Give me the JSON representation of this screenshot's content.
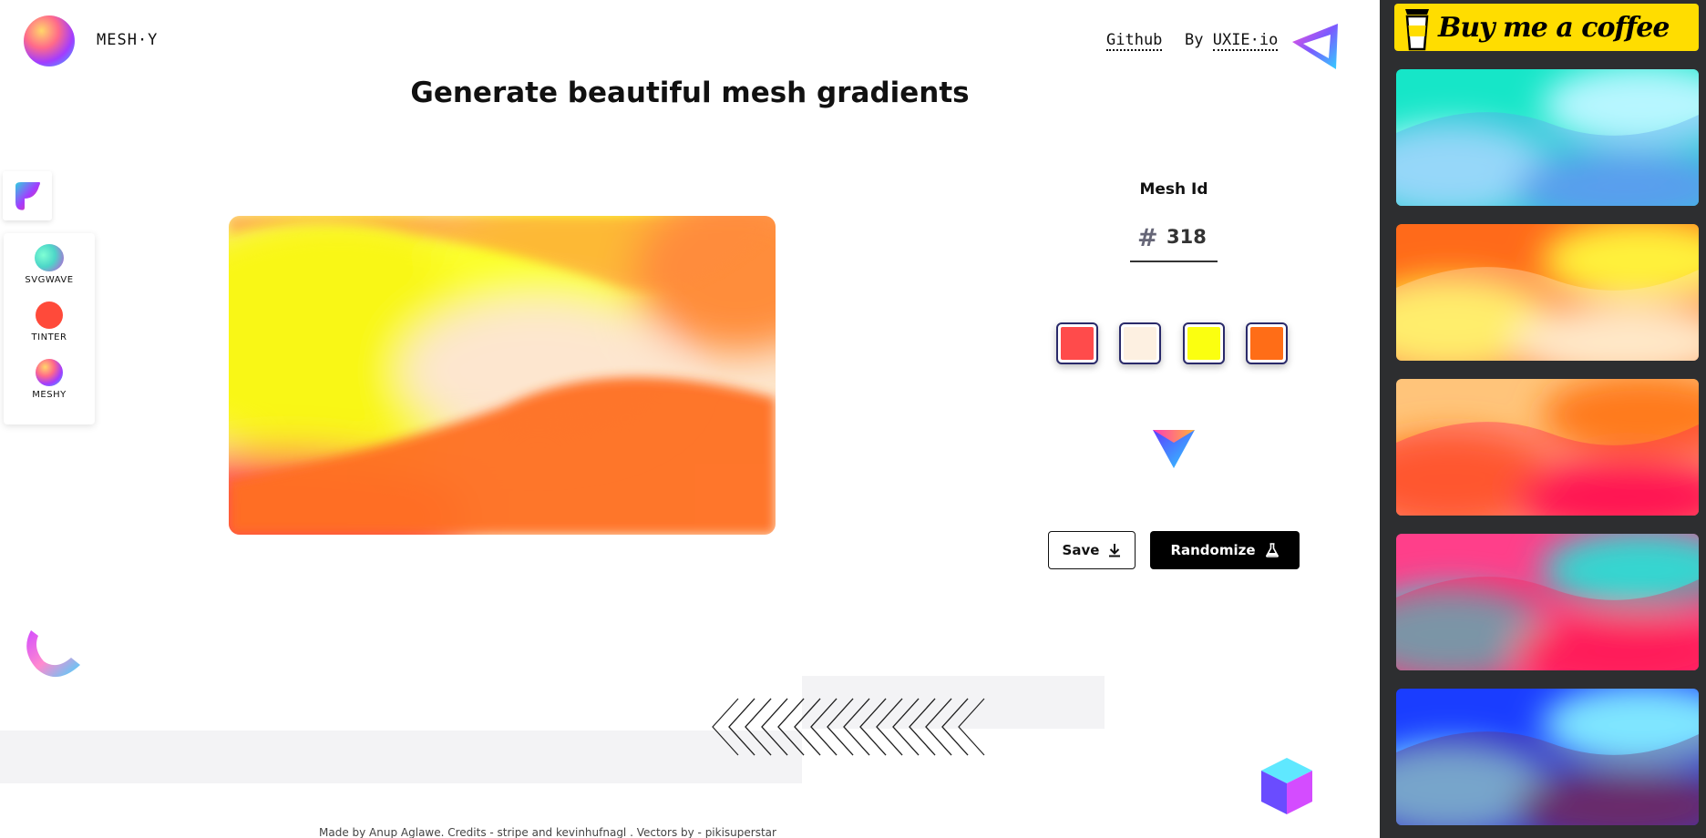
{
  "header": {
    "brand": "MESH·Y",
    "github_link": "Github",
    "by_prefix": "By ",
    "by_link": "UXIE·io",
    "headline": "Generate beautiful mesh gradients"
  },
  "dock": {
    "items": [
      {
        "label": "SVGWAVE"
      },
      {
        "label": "TINTER"
      },
      {
        "label": "MESHY"
      }
    ]
  },
  "editor": {
    "mesh_id_label": "Mesh Id",
    "hash": "#",
    "mesh_id_value": "318",
    "colors": [
      "#ff4b4b",
      "#fdf0e1",
      "#fbff10",
      "#ff6d17"
    ],
    "save_label": "Save",
    "randomize_label": "Randomize"
  },
  "footer": {
    "text": "Made by Anup Aglawe. Credits - stripe and kevinhufnagl . Vectors by - pikisuperstar"
  },
  "sidebar": {
    "coffee_label": "Buy me a coffee",
    "coffee_bg": "#ffdd00",
    "thumbnails": [
      {
        "colors": [
          "#16e6c8",
          "#b7f6ff",
          "#5a9fee"
        ]
      },
      {
        "colors": [
          "#ff6a1a",
          "#fff13a",
          "#ffe8c8"
        ]
      },
      {
        "colors": [
          "#ffc47a",
          "#ff7a1a",
          "#ff1353"
        ]
      },
      {
        "colors": [
          "#ff3f8a",
          "#36d6d0",
          "#ff1d5a"
        ]
      },
      {
        "colors": [
          "#1a3dff",
          "#7fe6ff",
          "#6a2a6a"
        ]
      }
    ]
  }
}
